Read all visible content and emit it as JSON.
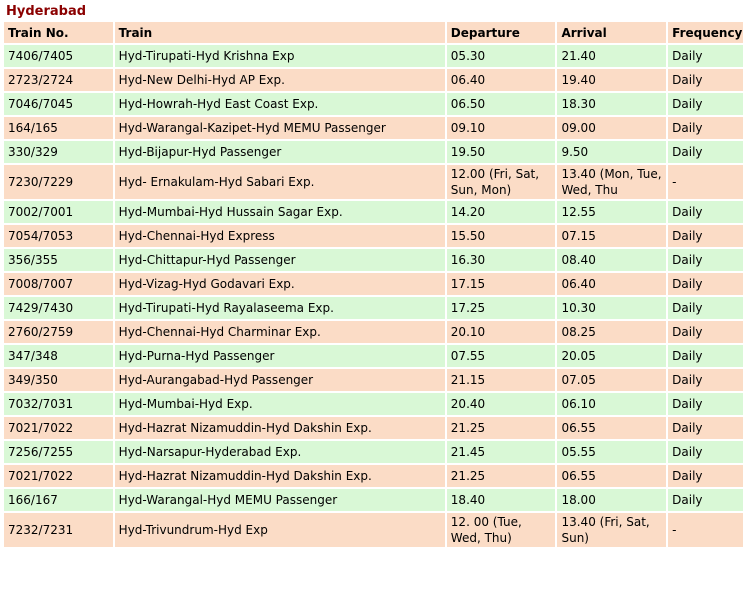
{
  "title": "Hyderabad",
  "headers": [
    "Train No.",
    "Train",
    "Departure",
    "Arrival",
    "Frequency"
  ],
  "rows": [
    [
      "7406/7405",
      "Hyd-Tirupati-Hyd Krishna Exp",
      "05.30",
      "21.40",
      "Daily"
    ],
    [
      "2723/2724",
      "Hyd-New Delhi-Hyd AP Exp.",
      "06.40",
      "19.40",
      "Daily"
    ],
    [
      "7046/7045",
      "Hyd-Howrah-Hyd East Coast Exp.",
      "06.50",
      "18.30",
      "Daily"
    ],
    [
      "164/165",
      "Hyd-Warangal-Kazipet-Hyd MEMU Passenger",
      "09.10",
      "09.00",
      "Daily"
    ],
    [
      "330/329",
      "Hyd-Bijapur-Hyd Passenger",
      "19.50",
      "9.50",
      "Daily"
    ],
    [
      "7230/7229",
      "Hyd- Ernakulam-Hyd Sabari Exp.",
      "12.00 (Fri, Sat, Sun, Mon)",
      "13.40 (Mon, Tue, Wed, Thu",
      "-"
    ],
    [
      "7002/7001",
      "Hyd-Mumbai-Hyd Hussain Sagar Exp.",
      "14.20",
      "12.55",
      "Daily"
    ],
    [
      "7054/7053",
      "Hyd-Chennai-Hyd Express",
      "15.50",
      "07.15",
      "Daily"
    ],
    [
      "356/355",
      "Hyd-Chittapur-Hyd Passenger",
      "16.30",
      "08.40",
      "Daily"
    ],
    [
      "7008/7007",
      "Hyd-Vizag-Hyd Godavari Exp.",
      "17.15",
      "06.40",
      "Daily"
    ],
    [
      "7429/7430",
      "Hyd-Tirupati-Hyd Rayalaseema Exp.",
      "17.25",
      "10.30",
      "Daily"
    ],
    [
      "2760/2759",
      "Hyd-Chennai-Hyd Charminar Exp.",
      "20.10",
      "08.25",
      "Daily"
    ],
    [
      "347/348",
      "Hyd-Purna-Hyd Passenger",
      "07.55",
      "20.05",
      "Daily"
    ],
    [
      "349/350",
      "Hyd-Aurangabad-Hyd Passenger",
      "21.15",
      "07.05",
      "Daily"
    ],
    [
      "7032/7031",
      "Hyd-Mumbai-Hyd Exp.",
      "20.40",
      "06.10",
      "Daily"
    ],
    [
      "7021/7022",
      "Hyd-Hazrat Nizamuddin-Hyd Dakshin Exp.",
      "21.25",
      "06.55",
      "Daily"
    ],
    [
      "7256/7255",
      "Hyd-Narsapur-Hyderabad Exp.",
      "21.45",
      "05.55",
      "Daily"
    ],
    [
      "7021/7022",
      "Hyd-Hazrat Nizamuddin-Hyd Dakshin Exp.",
      "21.25",
      "06.55",
      "Daily"
    ],
    [
      "166/167",
      "Hyd-Warangal-Hyd MEMU Passenger",
      "18.40",
      "18.00",
      "Daily"
    ],
    [
      "7232/7231",
      "Hyd-Trivundrum-Hyd Exp",
      "12. 00 (Tue, Wed, Thu)",
      "13.40 (Fri, Sat, Sun)",
      "-"
    ]
  ],
  "colors": {
    "title": "#8b0000",
    "row_green": "#d9f8d6",
    "row_peach": "#fbdcc6"
  }
}
